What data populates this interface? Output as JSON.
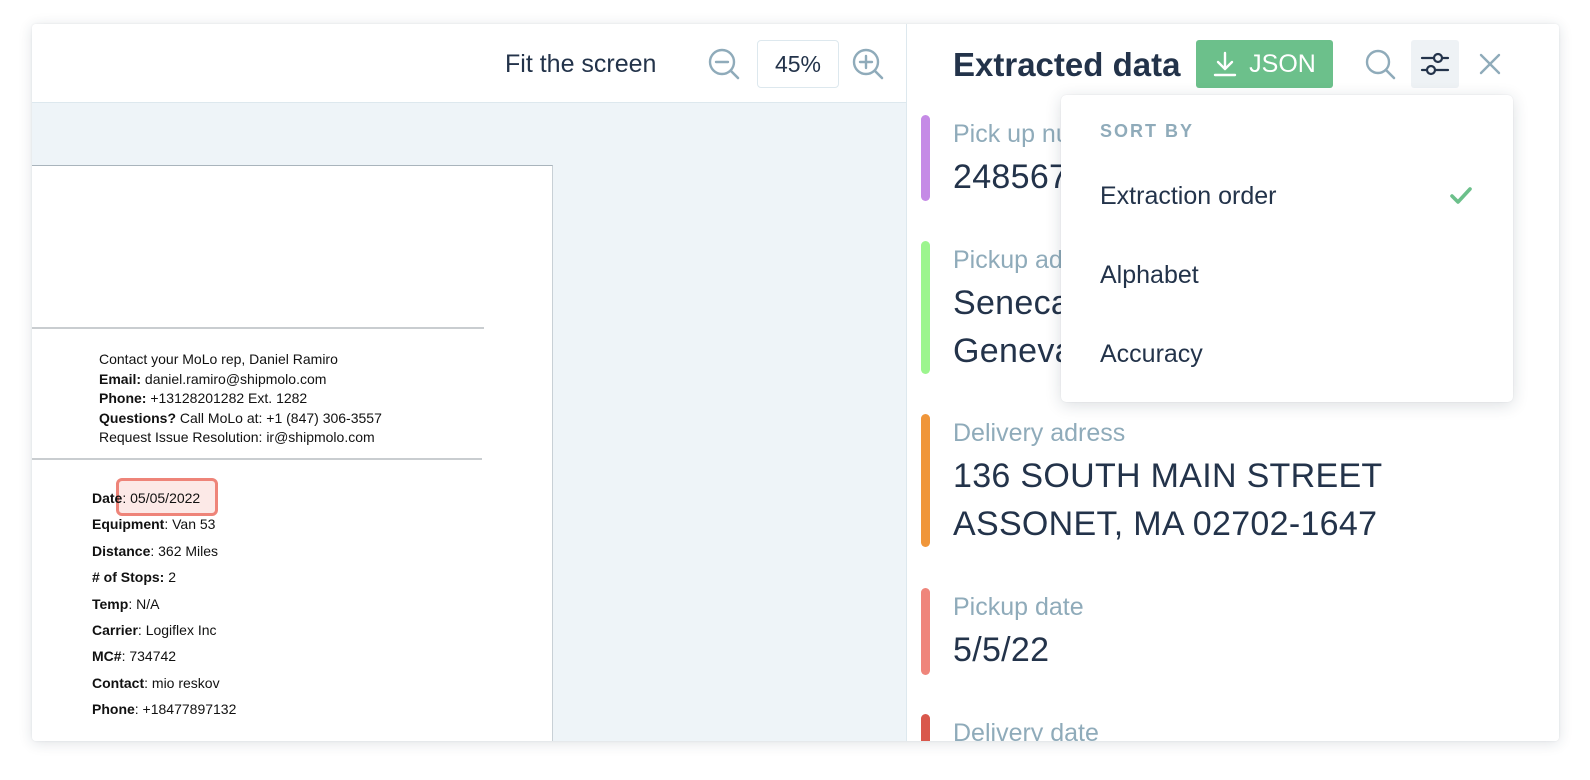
{
  "viewer": {
    "fit_label": "Fit the screen",
    "zoom_value": "45%",
    "zoom_out_icon": "zoom-out-icon",
    "zoom_in_icon": "zoom-in-icon"
  },
  "document": {
    "contact": {
      "line1": "Contact your MoLo rep, Daniel Ramiro",
      "email_label": "Email:",
      "email_value": " daniel.ramiro@shipmolo.com",
      "phone_label": "Phone:",
      "phone_value": " +13128201282 Ext. 1282",
      "questions_label": "Questions?",
      "questions_value": " Call MoLo at: +1 (847) 306-3557",
      "resolution": "Request Issue Resolution: ir@shipmolo.com"
    },
    "details": [
      {
        "label": "Date",
        "value": ": 05/05/2022"
      },
      {
        "label": "Equipment",
        "value": ": Van 53"
      },
      {
        "label": "Distance",
        "value": ": 362 Miles"
      },
      {
        "label": "# of Stops:",
        "value": " 2"
      },
      {
        "label": "Temp",
        "value": ": N/A"
      },
      {
        "label": "Carrier",
        "value": ": Logiflex Inc"
      },
      {
        "label": "MC#",
        "value": ": 734742"
      },
      {
        "label": "Contact",
        "value": ": mio reskov"
      },
      {
        "label": "Phone",
        "value": ": +18477897132"
      }
    ]
  },
  "panel": {
    "title": "Extracted data",
    "json_button": "JSON",
    "fields": [
      {
        "label": "Pick up number",
        "value": "248567",
        "color": "#c58ae6"
      },
      {
        "label": "Pickup address",
        "value_line1": "Seneca",
        "value_line2": "Geneva",
        "color": "#9cf58e"
      },
      {
        "label": "Delivery adress",
        "value_line1": "136 SOUTH MAIN STREET",
        "value_line2": "ASSONET, MA 02702-1647",
        "color": "#f0963a"
      },
      {
        "label": "Pickup date",
        "value": "5/5/22",
        "color": "#ef857b"
      },
      {
        "label": "Delivery date",
        "color": "#d9584c"
      }
    ]
  },
  "sort_menu": {
    "heading": "SORT BY",
    "options": [
      "Extraction order",
      "Alphabet",
      "Accuracy"
    ],
    "selected": "Extraction order",
    "check_color": "#6cc08b"
  },
  "colors": {
    "accent_green": "#6cc08b",
    "text_dark": "#23334a",
    "text_muted": "#8fabba",
    "highlight": "#ee8479"
  }
}
